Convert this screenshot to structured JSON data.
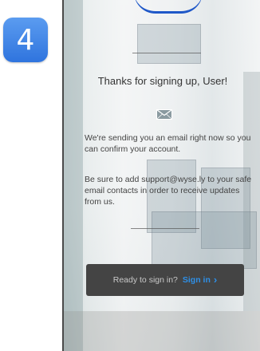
{
  "step": {
    "number": "4"
  },
  "confirmation": {
    "title": "Thanks for signing up, User!",
    "message": "We're sending you an email right now so you can confirm your account.",
    "safe_contacts_note": "Be sure to add support@wyse.ly to your safe email contacts in order to receive updates from us."
  },
  "signin_bar": {
    "prompt": "Ready to sign in?",
    "link_label": "Sign in",
    "chevron": "›"
  },
  "colors": {
    "step_badge": "#3d83e6",
    "link": "#2e8fe6",
    "bar": "#444444"
  },
  "icons": {
    "mail": "envelope-icon",
    "chevron": "chevron-right-icon"
  }
}
